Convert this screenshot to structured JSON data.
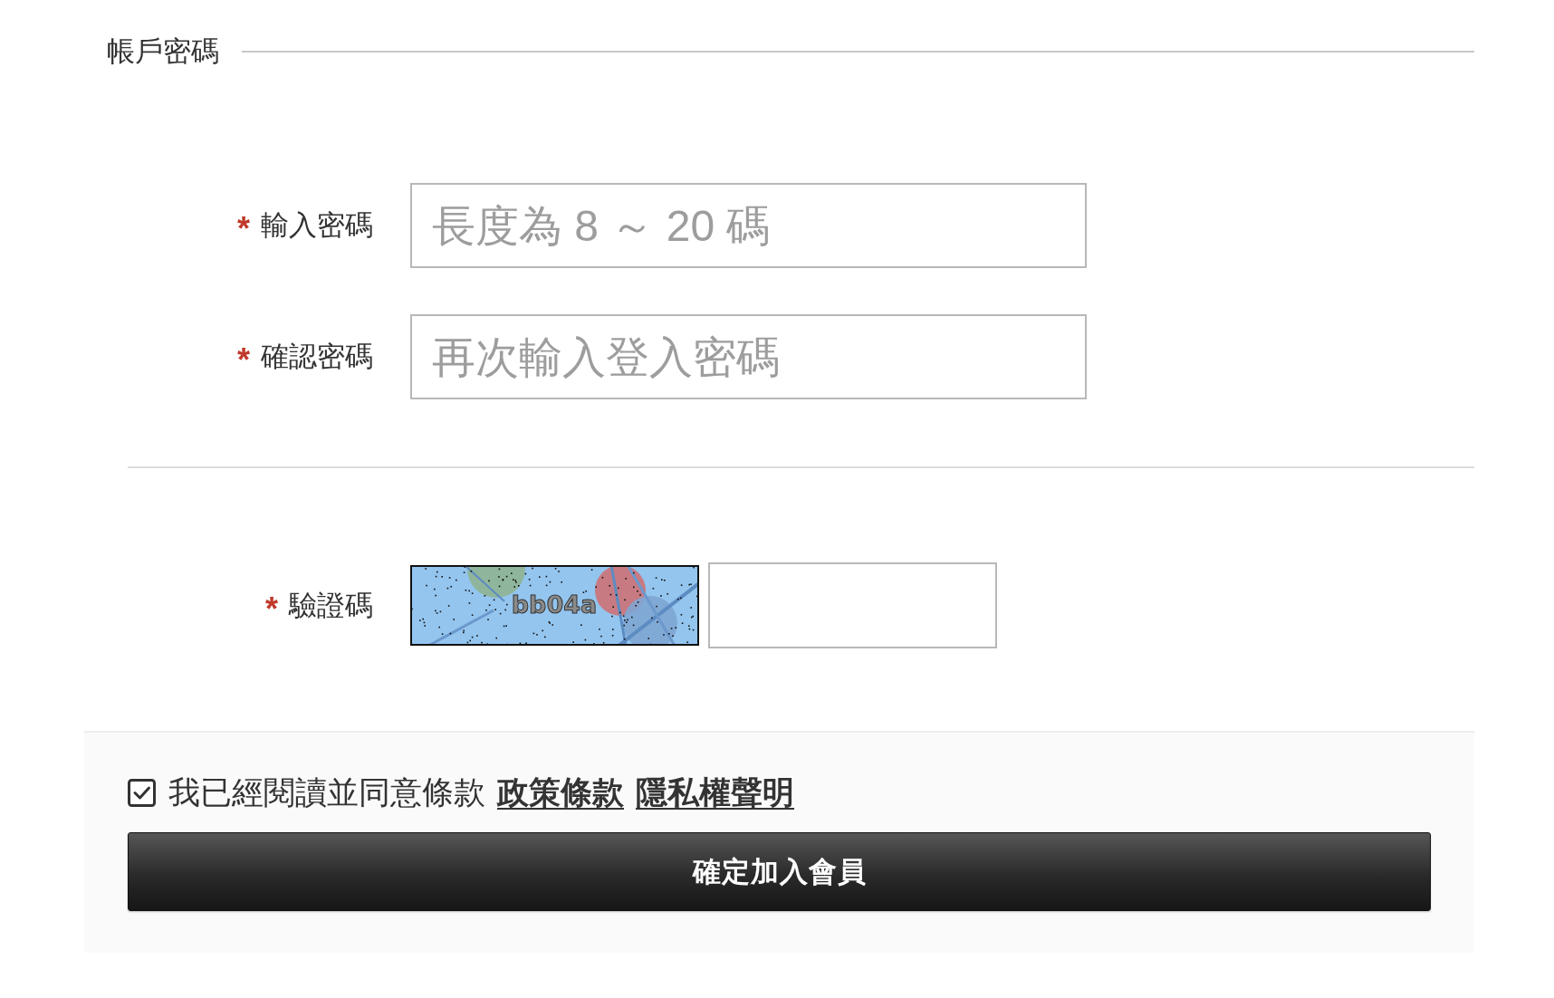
{
  "section": {
    "title": "帳戶密碼"
  },
  "fields": [
    {
      "required_mark": "*",
      "label": "輸入密碼",
      "placeholder": "長度為 8 ～ 20 碼"
    },
    {
      "required_mark": "*",
      "label": "確認密碼",
      "placeholder": "再次輸入登入密碼"
    }
  ],
  "captcha": {
    "required_mark": "*",
    "label": "驗證碼",
    "code": "bb04a"
  },
  "agreement": {
    "checked": true,
    "text": "我已經閱讀並同意條款",
    "links": [
      "政策條款",
      "隱私權聲明"
    ]
  },
  "submit_button": "確定加入會員"
}
